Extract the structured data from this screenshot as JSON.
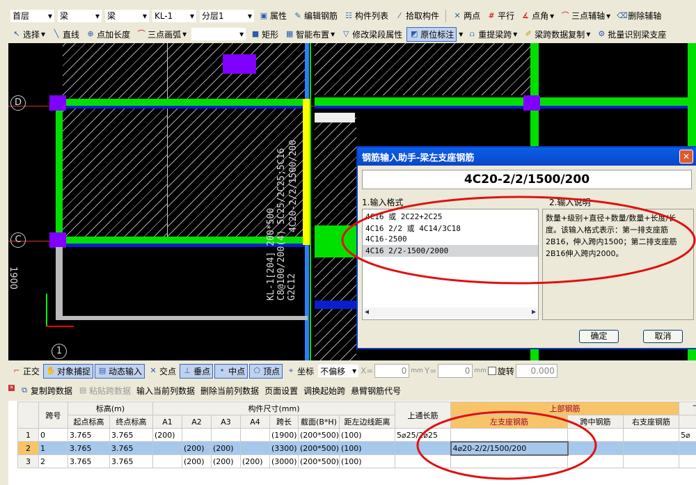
{
  "toolbar_top_partial": "…",
  "toolbar1": {
    "floor": "首层",
    "type1": "梁",
    "type2": "梁",
    "member": "KL-1",
    "layer": "分层1",
    "items": [
      "属性",
      "编辑钢筋",
      "构件列表",
      "拾取构件",
      "两点",
      "平行",
      "点角",
      "三点辅轴",
      "删除辅轴"
    ]
  },
  "toolbar2": {
    "items": [
      "选择",
      "直线",
      "点加长度",
      "三点画弧",
      "矩形",
      "智能布置",
      "修改梁段属性",
      "原位标注",
      "重提梁跨",
      "梁跨数据复制",
      "批量识别梁支座"
    ]
  },
  "canvas": {
    "axes": [
      "D",
      "C",
      "1"
    ],
    "dimension": "1900",
    "beam_label": [
      "KL-1[204] 200*500",
      "C8@100/200(4) 5C25/2C25;5C16",
      "G2C12"
    ],
    "beam_annotation": "4C20-2/2/1500/200",
    "colors": {
      "beam": "#00e000",
      "selected": "#ffff00",
      "column": "#8000ff",
      "axis": "#2a7fff"
    }
  },
  "dialog": {
    "title": "钢筋输入助手-梁左支座钢筋",
    "value": "4C20-2/2/1500/200",
    "format_label": "1.输入格式",
    "desc_label": "2.输入说明",
    "formats": [
      "4C16 或 2C22+2C25",
      "4C16 2/2 或 4C14/3C18",
      "4C16-2500",
      "4C16 2/2-1500/2000"
    ],
    "description": "数量+级别+直径+数量/数量+长度/长度。该输入格式表示：第一排支座筋2B16，伸入跨内1500；第二排支座筋2B16伸入跨内2000。",
    "ok": "确定",
    "cancel": "取消"
  },
  "statusbar": {
    "items": [
      "正交",
      "对象捕捉",
      "动态输入",
      "交点",
      "垂点",
      "中点",
      "顶点",
      "坐标"
    ],
    "offset": "不偏移",
    "x_label": "X=",
    "x": "0",
    "y_label": "Y=",
    "y": "0",
    "unit": "mm",
    "rotate": "旋转",
    "angle": "0.000"
  },
  "panel_toolbar": [
    "复制跨数据",
    "粘贴跨数据",
    "输入当前列数据",
    "删除当前列数据",
    "页面设置",
    "调换起始跨",
    "悬臂钢筋代号"
  ],
  "table": {
    "h_span": "跨号",
    "h_elev": "标高(m)",
    "h_size": "构件尺寸(mm)",
    "h_top_cont": "上通长筋",
    "h_top": "上部钢筋",
    "h_bottom": "下",
    "sub": [
      "起点标高",
      "终点标高",
      "A1",
      "A2",
      "A3",
      "A4",
      "跨长",
      "截面(B*H)",
      "距左边线距离"
    ],
    "top_sub": [
      "左支座钢筋",
      "跨中钢筋",
      "右支座钢筋"
    ],
    "rows": [
      [
        "1",
        "0",
        "3.765",
        "3.765",
        "(200)",
        "",
        "",
        "",
        "(1900)",
        "(200*500)",
        "(100)",
        "5⌀25/2⌀25",
        "",
        "",
        "",
        "5⌀"
      ],
      [
        "2",
        "1",
        "3.765",
        "3.765",
        "",
        "(200)",
        "(200)",
        "",
        "(3300)",
        "(200*500)",
        "(100)",
        "",
        "4⌀20-2/2/1500/200",
        "",
        "",
        ""
      ],
      [
        "3",
        "2",
        "3.765",
        "3.765",
        "",
        "(200)",
        "(200)",
        "(200)",
        "(3000)",
        "(200*500)",
        "(100)",
        "",
        "",
        "",
        "",
        ""
      ]
    ]
  }
}
